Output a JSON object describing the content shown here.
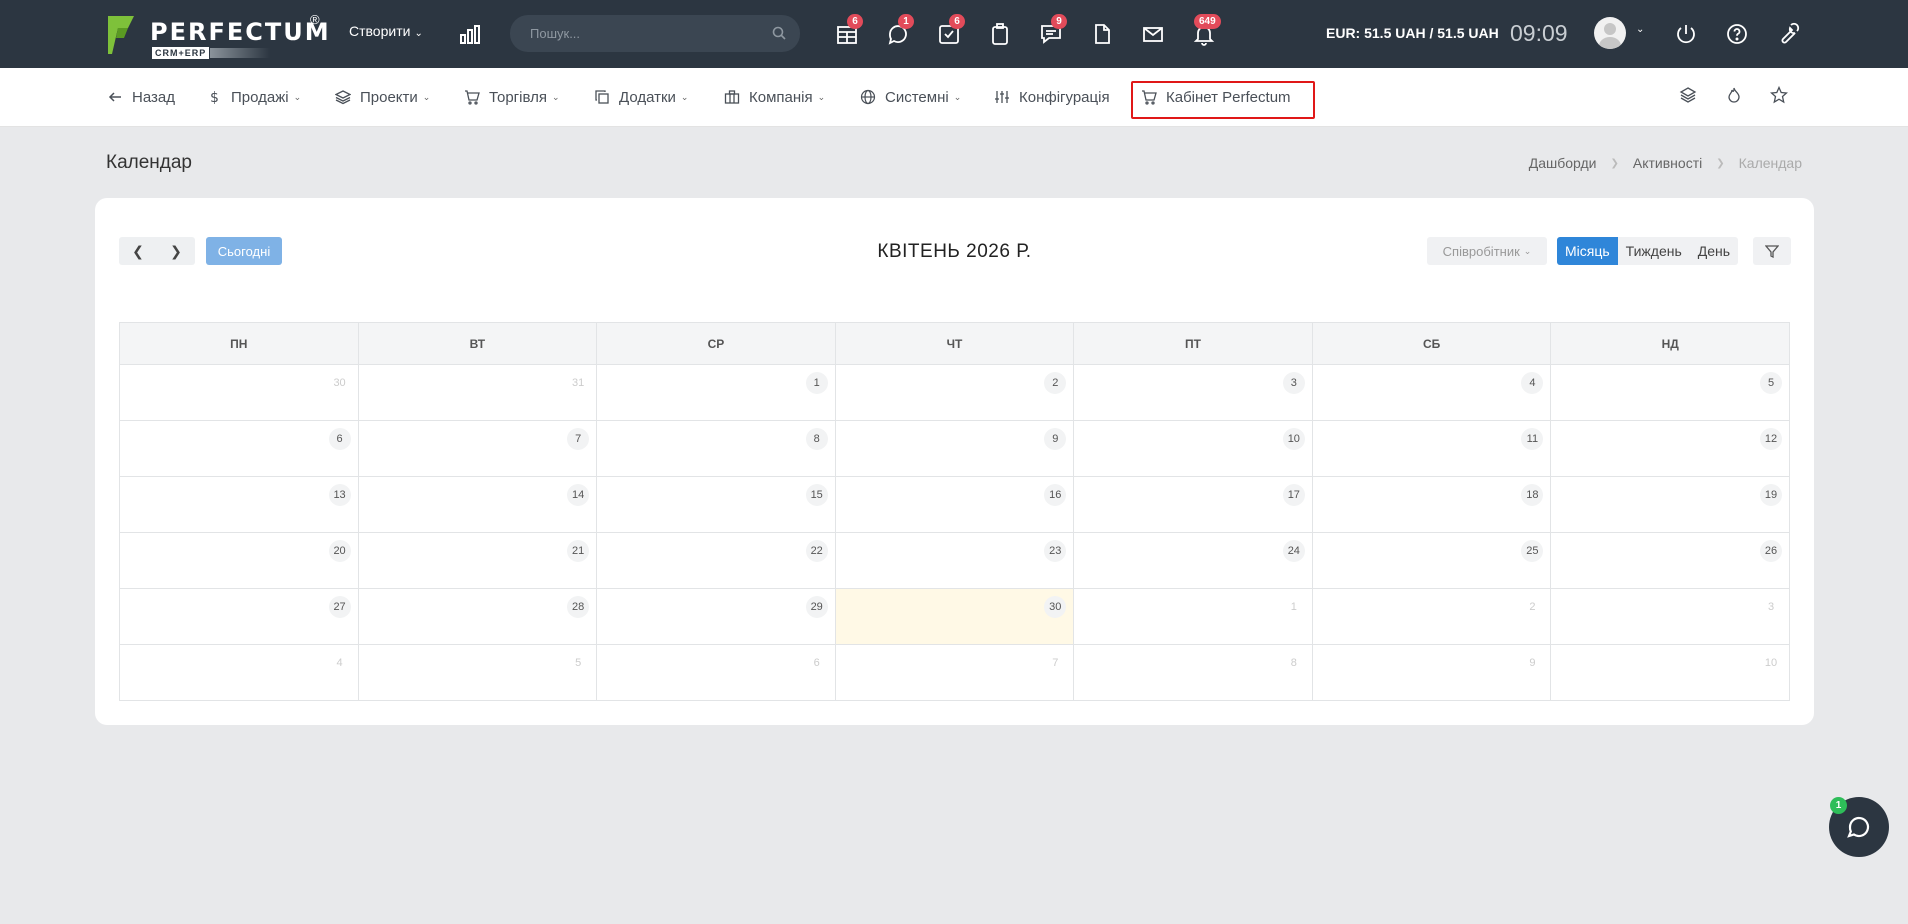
{
  "brand": {
    "name": "PERFECTUM",
    "reg": "®",
    "sub": "CRM+ERP"
  },
  "topbar": {
    "create_label": "Створити",
    "search_placeholder": "Пошук...",
    "badges": {
      "calendar": "6",
      "chat": "1",
      "tasks": "6",
      "messages": "9",
      "notifications": "649"
    },
    "rate": "EUR: 51.5 UAH / 51.5 UAH",
    "time": "09:09"
  },
  "nav": {
    "back": "Назад",
    "sales": "Продажі",
    "projects": "Проекти",
    "trade": "Торгівля",
    "addons": "Додатки",
    "company": "Компанія",
    "system": "Системні",
    "config": "Конфігурація",
    "cabinet": "Кабінет Perfectum"
  },
  "page": {
    "title": "Календар",
    "breadcrumbs": [
      "Дашборди",
      "Активності",
      "Календар"
    ]
  },
  "calendar": {
    "today_label": "Сьогодні",
    "month_title": "КВІТЕНЬ 2026 Р.",
    "employee_label": "Співробітник",
    "views": [
      "Місяць",
      "Тиждень",
      "День"
    ],
    "active_view": "Місяць",
    "weekdays": [
      "ПН",
      "ВТ",
      "СР",
      "ЧТ",
      "ПТ",
      "СБ",
      "НД"
    ],
    "weeks": [
      [
        {
          "d": "30",
          "o": true
        },
        {
          "d": "31",
          "o": true
        },
        {
          "d": "1"
        },
        {
          "d": "2"
        },
        {
          "d": "3"
        },
        {
          "d": "4"
        },
        {
          "d": "5"
        }
      ],
      [
        {
          "d": "6"
        },
        {
          "d": "7"
        },
        {
          "d": "8"
        },
        {
          "d": "9"
        },
        {
          "d": "10"
        },
        {
          "d": "11"
        },
        {
          "d": "12"
        }
      ],
      [
        {
          "d": "13"
        },
        {
          "d": "14"
        },
        {
          "d": "15"
        },
        {
          "d": "16"
        },
        {
          "d": "17"
        },
        {
          "d": "18"
        },
        {
          "d": "19"
        }
      ],
      [
        {
          "d": "20"
        },
        {
          "d": "21"
        },
        {
          "d": "22"
        },
        {
          "d": "23"
        },
        {
          "d": "24"
        },
        {
          "d": "25"
        },
        {
          "d": "26"
        }
      ],
      [
        {
          "d": "27"
        },
        {
          "d": "28"
        },
        {
          "d": "29"
        },
        {
          "d": "30",
          "t": true
        },
        {
          "d": "1",
          "o": true
        },
        {
          "d": "2",
          "o": true
        },
        {
          "d": "3",
          "o": true
        }
      ],
      [
        {
          "d": "4",
          "o": true
        },
        {
          "d": "5",
          "o": true
        },
        {
          "d": "6",
          "o": true
        },
        {
          "d": "7",
          "o": true
        },
        {
          "d": "8",
          "o": true
        },
        {
          "d": "9",
          "o": true
        },
        {
          "d": "10",
          "o": true
        }
      ]
    ]
  },
  "chat": {
    "badge": "1"
  },
  "colors": {
    "topbar": "#2c3641",
    "accent": "#2f86d9",
    "badge": "#e24b5a",
    "highlight": "#e01818"
  }
}
